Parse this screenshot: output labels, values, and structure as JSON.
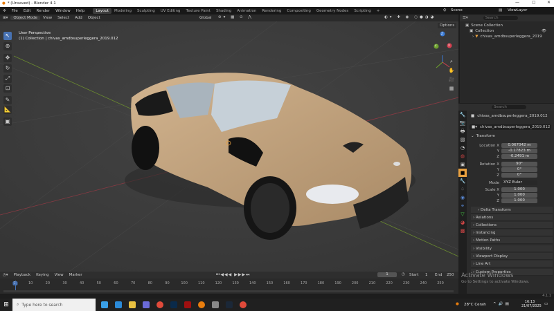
{
  "window": {
    "title": "* (Unsaved) - Blender 4.1",
    "min": "—",
    "max": "▢",
    "close": "✕"
  },
  "menu": [
    "File",
    "Edit",
    "Render",
    "Window",
    "Help"
  ],
  "workspaces": [
    {
      "label": "Layout",
      "active": true
    },
    {
      "label": "Modeling"
    },
    {
      "label": "Sculpting"
    },
    {
      "label": "UV Editing"
    },
    {
      "label": "Texture Paint"
    },
    {
      "label": "Shading"
    },
    {
      "label": "Animation"
    },
    {
      "label": "Rendering"
    },
    {
      "label": "Compositing"
    },
    {
      "label": "Geometry Nodes"
    },
    {
      "label": "Scripting"
    },
    {
      "label": "+"
    }
  ],
  "scene": {
    "label": "Scene",
    "view_layer": "ViewLayer"
  },
  "viewport_header": {
    "mode": "Object Mode",
    "menus": [
      "View",
      "Select",
      "Add",
      "Object"
    ],
    "orientation": "Global",
    "options": "Options"
  },
  "viewport": {
    "overlay_title": "User Perspective",
    "overlay_sub": "(1) Collection | chivas_amdbsuperleggera_2019.012",
    "gizmo": {
      "x": "X",
      "y": "Y",
      "z": "Z"
    }
  },
  "outliner": {
    "search_placeholder": "Search",
    "items": [
      "Scene Collection",
      "Collection",
      "chivas_amdbsuperleggera_2019"
    ]
  },
  "properties": {
    "search_placeholder": "Search",
    "object_name": "chivas_amdbsuperleggera_2019.012",
    "object_field": "chivas_amdbsuperleggera_2019.012",
    "transform_label": "Transform",
    "location": {
      "label": "Location X",
      "x": "0.067042 m",
      "y": "-0.17823 m",
      "z": "-0.2491 m"
    },
    "rotation": {
      "label": "Rotation X",
      "x": "90°",
      "y": "0°",
      "z": "0°"
    },
    "mode": {
      "label": "Mode",
      "value": "XYZ Euler"
    },
    "scale": {
      "label": "Scale X",
      "x": "1.000",
      "y": "1.000",
      "z": "1.000"
    },
    "axis_labels": {
      "y": "Y",
      "z": "Z"
    },
    "panels": [
      "Delta Transform",
      "Relations",
      "Collections",
      "Instancing",
      "Motion Paths",
      "Visibility",
      "Viewport Display",
      "Line Art",
      "Custom Properties"
    ]
  },
  "timeline": {
    "menus": [
      "Playback",
      "Keying",
      "View",
      "Marker"
    ],
    "current_frame": "1",
    "start_label": "Start",
    "start": "1",
    "end_label": "End",
    "end": "250",
    "ticks": [
      "1",
      "10",
      "20",
      "30",
      "40",
      "50",
      "60",
      "70",
      "80",
      "90",
      "100",
      "110",
      "120",
      "130",
      "140",
      "150",
      "160",
      "170",
      "180",
      "190",
      "200",
      "210",
      "220",
      "230",
      "240",
      "250"
    ]
  },
  "activate": {
    "title": "Activate Windows",
    "sub": "Go to Settings to activate Windows."
  },
  "version": "4.1.1",
  "taskbar": {
    "search_placeholder": "Type here to search",
    "weather": "28°C  Cerah",
    "time": "16:13",
    "date": "21/07/2025"
  },
  "colors": {
    "accent": "#4772b3",
    "car_body": "#b89a76"
  }
}
